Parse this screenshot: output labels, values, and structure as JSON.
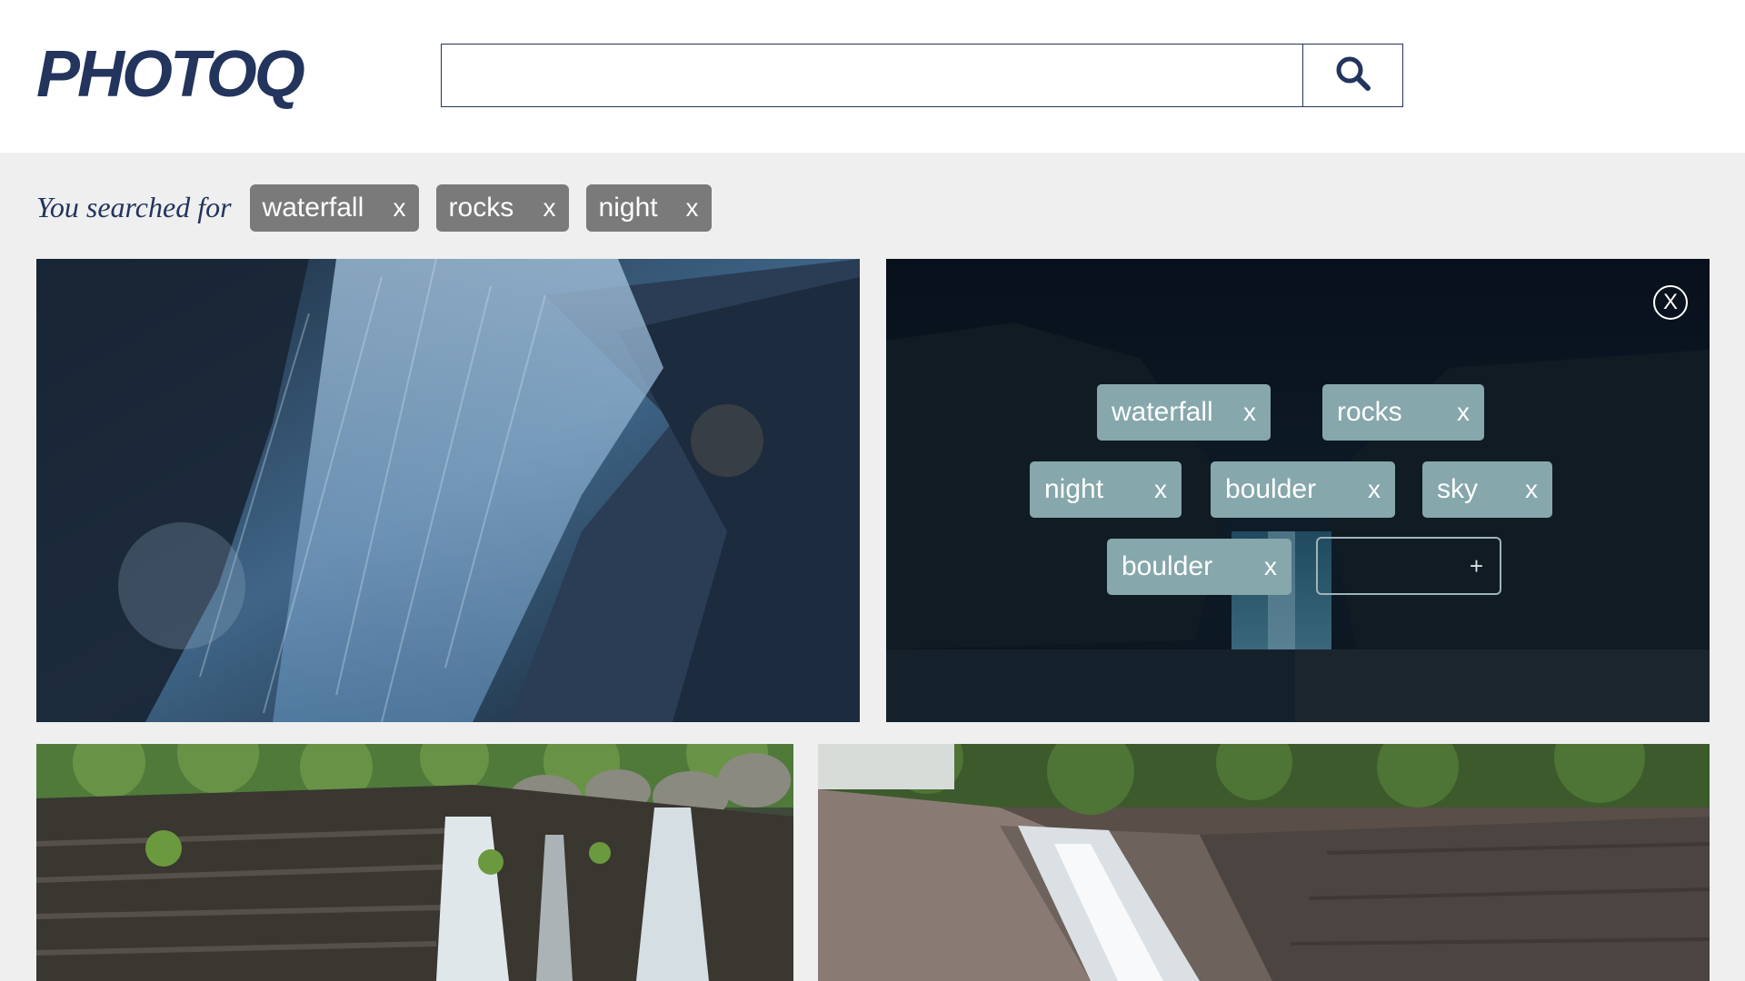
{
  "app": {
    "logo": "PHOTOQ"
  },
  "search": {
    "value": "",
    "placeholder": "",
    "button_icon": "search-icon"
  },
  "searched": {
    "label": "You searched for",
    "chips": [
      {
        "label": "waterfall",
        "remove": "x"
      },
      {
        "label": "rocks",
        "remove": "x"
      },
      {
        "label": "night",
        "remove": "x"
      }
    ]
  },
  "tag_editor": {
    "close": "X",
    "tags": [
      {
        "label": "waterfall",
        "remove": "x"
      },
      {
        "label": "rocks",
        "remove": "x"
      },
      {
        "label": "night",
        "remove": "x"
      },
      {
        "label": "boulder",
        "remove": "x"
      },
      {
        "label": "sky",
        "remove": "x"
      },
      {
        "label": "boulder",
        "remove": "x"
      }
    ],
    "add_input": {
      "value": "",
      "placeholder": ""
    },
    "add_icon": "+"
  },
  "colors": {
    "brand": "#23345d",
    "chip": "#7a7a7a",
    "tag": "#86a7ab",
    "background": "#efefef"
  },
  "images": [
    {
      "name": "waterfall-closeup-photo"
    },
    {
      "name": "night-waterfall-photo"
    },
    {
      "name": "forest-cascade-photo"
    },
    {
      "name": "rock-slide-waterfall-photo"
    }
  ]
}
